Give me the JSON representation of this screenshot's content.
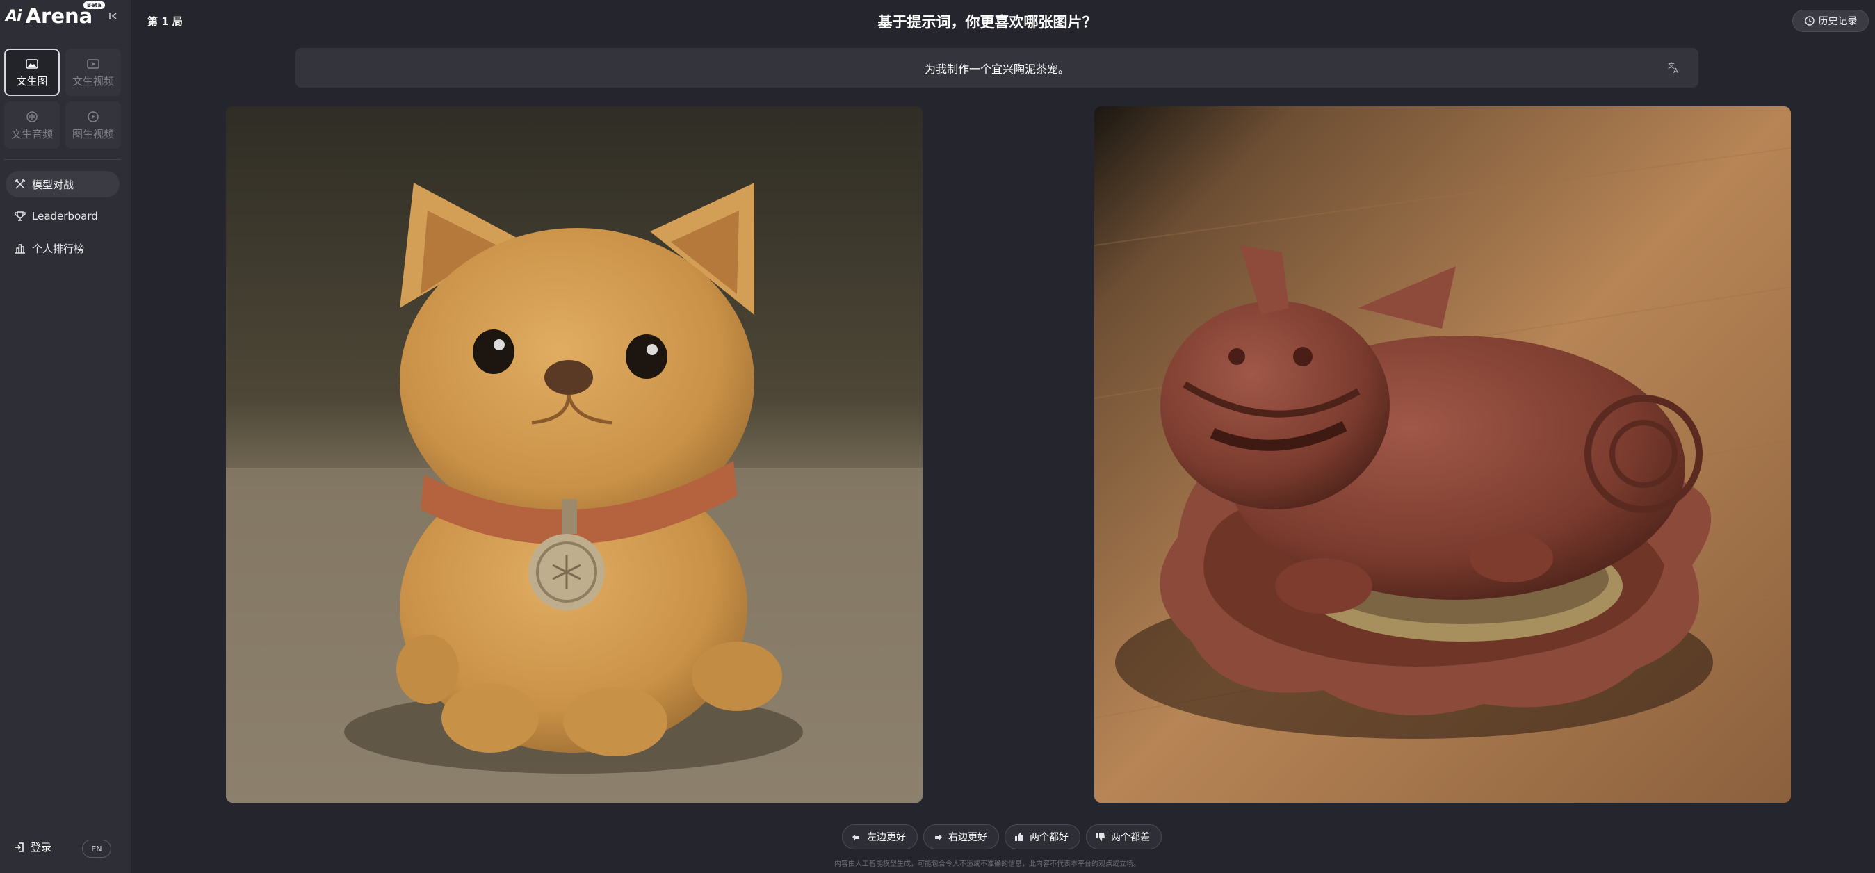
{
  "app": {
    "logo_mark": "Ai",
    "logo_text": "Arena",
    "beta_badge": "Beta"
  },
  "sidebar": {
    "modes": [
      {
        "label": "文生图",
        "active": true,
        "icon": "image-icon"
      },
      {
        "label": "文生视频",
        "active": false,
        "icon": "video-icon"
      },
      {
        "label": "文生音频",
        "active": false,
        "icon": "audio-icon"
      },
      {
        "label": "图生视频",
        "active": false,
        "icon": "image-to-video-icon"
      }
    ],
    "nav": [
      {
        "label": "模型对战",
        "active": true,
        "icon": "battle-icon"
      },
      {
        "label": "Leaderboard",
        "active": false,
        "icon": "trophy-icon"
      },
      {
        "label": "个人排行榜",
        "active": false,
        "icon": "bar-chart-icon"
      }
    ],
    "login_label": "登录",
    "lang_label": "EN"
  },
  "header": {
    "round": "第 1 局",
    "title": "基于提示词，你更喜欢哪张图片？",
    "history_label": "历史记录"
  },
  "prompt": {
    "text": "为我制作一个宜兴陶泥茶宠。"
  },
  "images": {
    "left": {
      "subject": "clay-dog-figurine"
    },
    "right": {
      "subject": "purple-clay-pixiu-figurine"
    }
  },
  "vote": {
    "left_better": "左边更好",
    "right_better": "右边更好",
    "both_good": "两个都好",
    "both_bad": "两个都差"
  },
  "disclaimer": "内容由人工智能模型生成，可能包含令人不适或不准确的信息，此内容不代表本平台的观点或立场。",
  "colors": {
    "background": "#25262d",
    "sidebar": "#2e2f36",
    "card": "#34353c"
  }
}
